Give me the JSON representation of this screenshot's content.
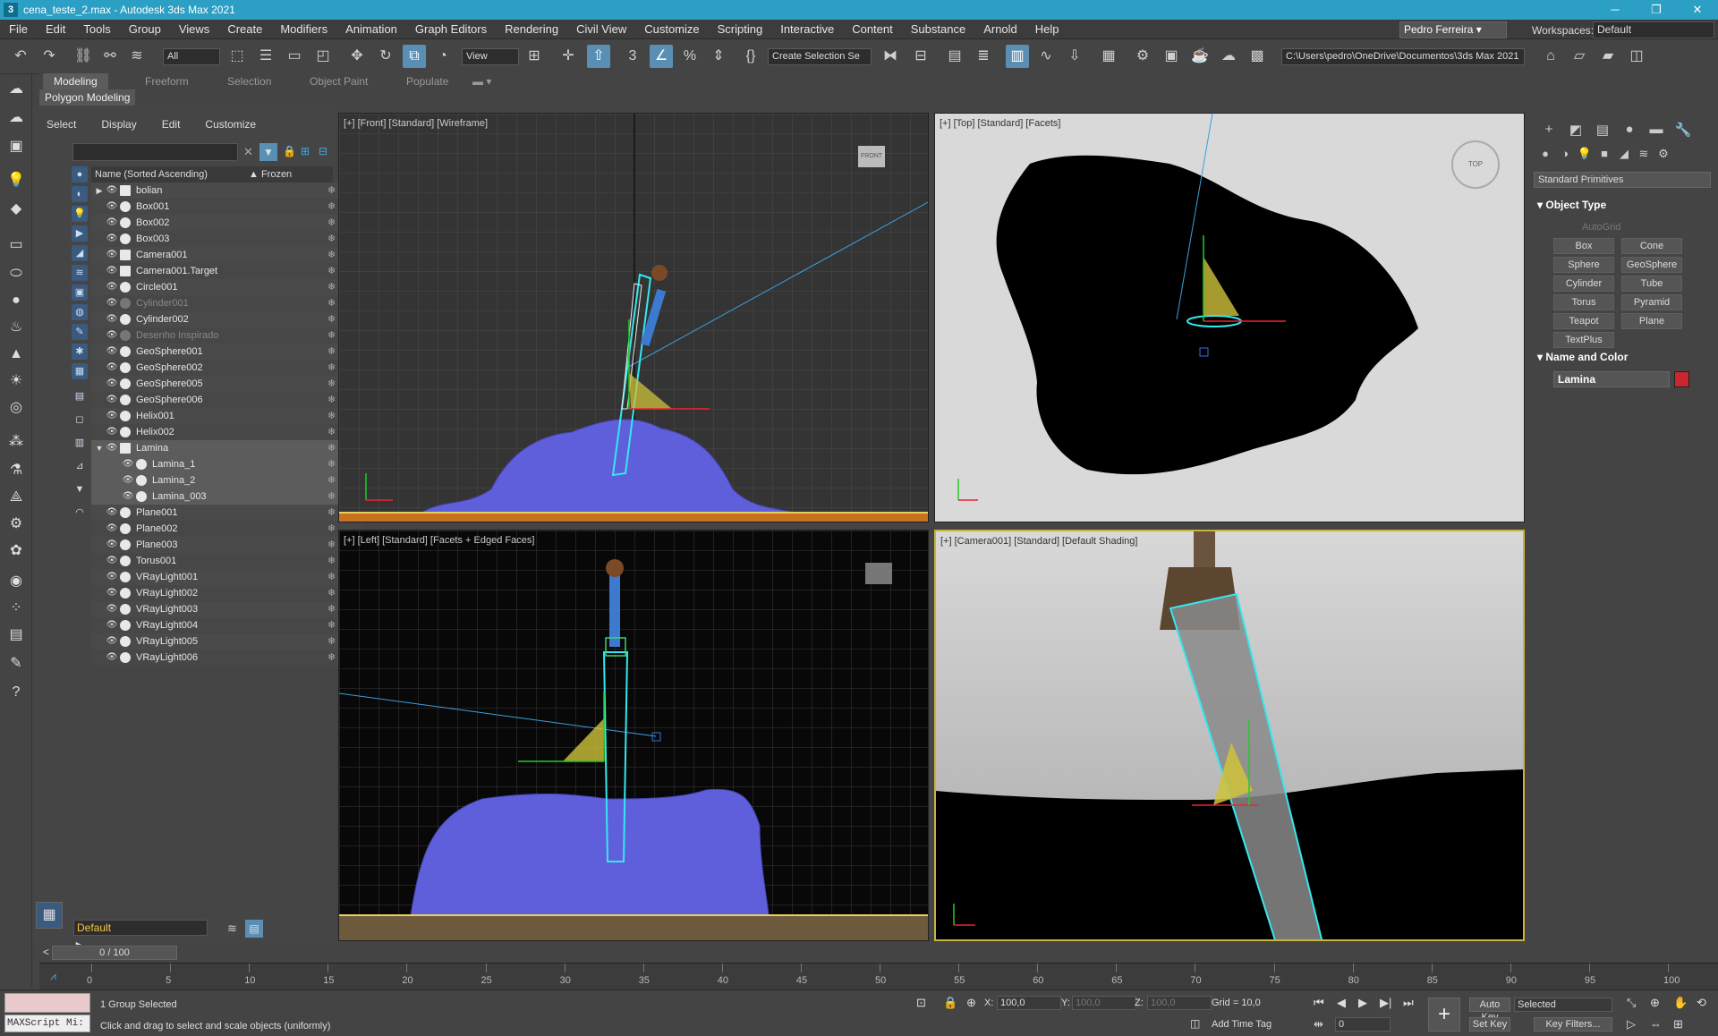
{
  "window": {
    "title": "cena_teste_2.max - Autodesk 3ds Max 2021",
    "app_icon_letter": "3",
    "minimize": "─",
    "maximize": "❐",
    "close": "✕"
  },
  "menu": [
    "File",
    "Edit",
    "Tools",
    "Group",
    "Views",
    "Create",
    "Modifiers",
    "Animation",
    "Graph Editors",
    "Rendering",
    "Civil View",
    "Customize",
    "Scripting",
    "Interactive",
    "Content",
    "Substance",
    "Arnold",
    "Help"
  ],
  "user": {
    "name": "Pedro Ferreira ▾",
    "workspaces_label": "Workspaces:",
    "workspace": "Default"
  },
  "toolbar": {
    "filter": "All",
    "ref_coord": "View",
    "selection_set": "Create Selection Se",
    "path": "C:\\Users\\pedro\\OneDrive\\Documentos\\3ds Max 2021"
  },
  "ribbon": {
    "tabs": [
      "Modeling",
      "Freeform",
      "Selection",
      "Object Paint",
      "Populate"
    ],
    "sub": "Polygon Modeling"
  },
  "scene_explorer": {
    "menu": [
      "Select",
      "Display",
      "Edit",
      "Customize"
    ],
    "col_name": "Name (Sorted Ascending)",
    "col_frozen": "▲ Frozen",
    "layer": "Default",
    "rows": [
      {
        "name": "bolian",
        "indent": 0,
        "expander": "▶",
        "kind": "group",
        "dim": false,
        "sel": false
      },
      {
        "name": "Box001",
        "indent": 0,
        "kind": "geo",
        "dim": false,
        "sel": false
      },
      {
        "name": "Box002",
        "indent": 0,
        "kind": "geo",
        "dim": false,
        "sel": false
      },
      {
        "name": "Box003",
        "indent": 0,
        "kind": "geo",
        "dim": false,
        "sel": false
      },
      {
        "name": "Camera001",
        "indent": 0,
        "kind": "cam",
        "dim": false,
        "sel": false
      },
      {
        "name": "Camera001.Target",
        "indent": 0,
        "kind": "cam",
        "dim": false,
        "sel": false
      },
      {
        "name": "Circle001",
        "indent": 0,
        "kind": "shape",
        "dim": false,
        "sel": false
      },
      {
        "name": "Cylinder001",
        "indent": 0,
        "kind": "geo",
        "dim": true,
        "sel": false
      },
      {
        "name": "Cylinder002",
        "indent": 0,
        "kind": "geo",
        "dim": false,
        "sel": false
      },
      {
        "name": "Desenho Inspirado",
        "indent": 0,
        "kind": "geo",
        "dim": true,
        "sel": false
      },
      {
        "name": "GeoSphere001",
        "indent": 0,
        "kind": "geo",
        "dim": false,
        "sel": false
      },
      {
        "name": "GeoSphere002",
        "indent": 0,
        "kind": "geo",
        "dim": false,
        "sel": false
      },
      {
        "name": "GeoSphere005",
        "indent": 0,
        "kind": "geo",
        "dim": false,
        "sel": false
      },
      {
        "name": "GeoSphere006",
        "indent": 0,
        "kind": "geo",
        "dim": false,
        "sel": false
      },
      {
        "name": "Helix001",
        "indent": 0,
        "kind": "shape",
        "dim": false,
        "sel": false
      },
      {
        "name": "Helix002",
        "indent": 0,
        "kind": "shape",
        "dim": false,
        "sel": false
      },
      {
        "name": "Lamina",
        "indent": 0,
        "expander": "▼",
        "kind": "group",
        "dim": false,
        "sel": true
      },
      {
        "name": "Lamina_1",
        "indent": 1,
        "kind": "geo",
        "dim": false,
        "sel": true
      },
      {
        "name": "Lamina_2",
        "indent": 1,
        "kind": "geo",
        "dim": false,
        "sel": true
      },
      {
        "name": "Lamina_003",
        "indent": 1,
        "kind": "geo",
        "dim": false,
        "sel": true
      },
      {
        "name": "Plane001",
        "indent": 0,
        "kind": "geo",
        "dim": false,
        "sel": false
      },
      {
        "name": "Plane002",
        "indent": 0,
        "kind": "geo",
        "dim": false,
        "sel": false
      },
      {
        "name": "Plane003",
        "indent": 0,
        "kind": "geo",
        "dim": false,
        "sel": false
      },
      {
        "name": "Torus001",
        "indent": 0,
        "kind": "geo",
        "dim": false,
        "sel": false
      },
      {
        "name": "VRayLight001",
        "indent": 0,
        "kind": "light",
        "dim": false,
        "sel": false
      },
      {
        "name": "VRayLight002",
        "indent": 0,
        "kind": "light",
        "dim": false,
        "sel": false
      },
      {
        "name": "VRayLight003",
        "indent": 0,
        "kind": "light",
        "dim": false,
        "sel": false
      },
      {
        "name": "VRayLight004",
        "indent": 0,
        "kind": "light",
        "dim": false,
        "sel": false
      },
      {
        "name": "VRayLight005",
        "indent": 0,
        "kind": "light",
        "dim": false,
        "sel": false
      },
      {
        "name": "VRayLight006",
        "indent": 0,
        "kind": "light",
        "dim": false,
        "sel": false
      }
    ]
  },
  "viewports": {
    "front": "[+] [Front] [Standard] [Wireframe]",
    "top": "[+] [Top] [Standard] [Facets]",
    "left": "[+] [Left] [Standard] [Facets + Edged Faces]",
    "camera": "[+] [Camera001] [Standard] [Default Shading]",
    "viewcube_front": "FRONT",
    "viewcube_top": "TOP"
  },
  "command_panel": {
    "category": "Standard Primitives",
    "object_type_title": "Object Type",
    "autogrid": "AutoGrid",
    "primitives": [
      "Box",
      "Cone",
      "Sphere",
      "GeoSphere",
      "Cylinder",
      "Tube",
      "Torus",
      "Pyramid",
      "Teapot",
      "Plane",
      "TextPlus"
    ],
    "name_color_title": "Name and Color",
    "object_name": "Lamina",
    "object_color": "#c8272f"
  },
  "timeline": {
    "frame": "0 / 100",
    "ticks": [
      "0",
      "5",
      "10",
      "15",
      "20",
      "25",
      "30",
      "35",
      "40",
      "45",
      "50",
      "55",
      "60",
      "65",
      "70",
      "75",
      "80",
      "85",
      "90",
      "95",
      "100"
    ]
  },
  "status": {
    "maxscript": "MAXScript Mi:",
    "selected": "1 Group Selected",
    "prompt": "Click and drag to select and scale objects (uniformly)",
    "x_label": "X:",
    "x": "100,0",
    "y_label": "Y:",
    "y": "100,0",
    "z_label": "Z:",
    "z": "100,0",
    "grid": "Grid = 10,0",
    "add_time_tag": "Add Time Tag",
    "auto_key": "Auto Key",
    "set_key": "Set Key",
    "key_mode": "Selected",
    "frame_field": "0",
    "key_filters": "Key Filters..."
  }
}
